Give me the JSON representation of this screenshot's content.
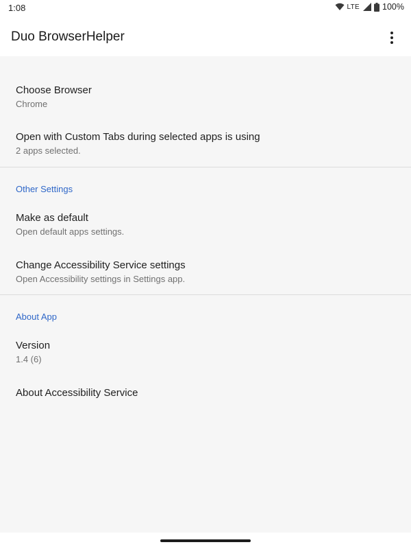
{
  "status": {
    "time": "1:08",
    "network": "LTE",
    "battery": "100%"
  },
  "app_bar": {
    "title": "Duo BrowserHelper",
    "overflow_icon": "more-vert-icon"
  },
  "preferences": [
    {
      "title": "Choose Browser",
      "summary": "Chrome"
    },
    {
      "title": "Open with Custom Tabs during selected apps is using",
      "summary": "2 apps selected."
    }
  ],
  "sections": [
    {
      "header": "Other Settings",
      "items": [
        {
          "title": "Make as default",
          "summary": "Open default apps settings."
        },
        {
          "title": "Change Accessibility Service settings",
          "summary": "Open Accessibility settings in Settings app."
        }
      ]
    },
    {
      "header": "About App",
      "items": [
        {
          "title": "Version",
          "summary": "1.4 (6)"
        },
        {
          "title": "About Accessibility Service",
          "summary": ""
        }
      ]
    }
  ],
  "colors": {
    "accent": "#2f67c8",
    "background": "#f6f6f6",
    "app_bar": "#ffffff"
  }
}
